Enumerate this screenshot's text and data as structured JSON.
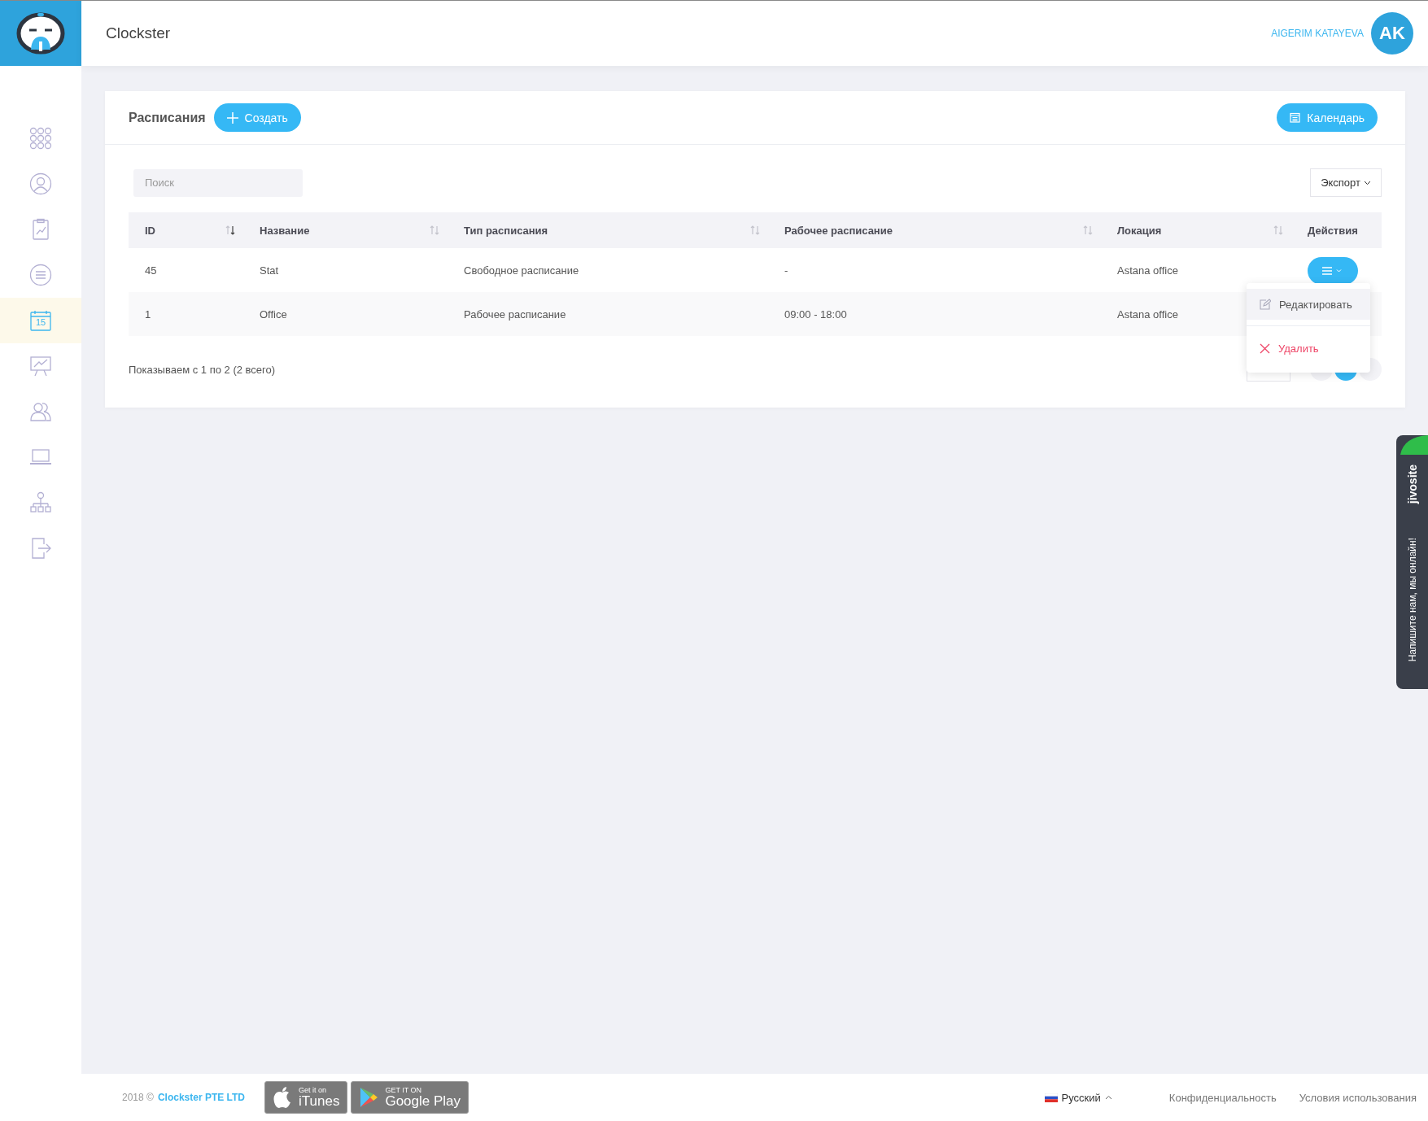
{
  "header": {
    "app_title": "Clockster",
    "user_name": "AIGERIM KATAYEVA",
    "avatar_initials": "AK"
  },
  "sidebar": {
    "items": [
      {
        "selected": false
      },
      {
        "selected": false
      },
      {
        "selected": false
      },
      {
        "selected": false
      },
      {
        "label": "15",
        "selected": true
      },
      {
        "selected": false
      },
      {
        "selected": false
      },
      {
        "selected": false
      },
      {
        "selected": false
      },
      {
        "selected": false
      }
    ]
  },
  "card": {
    "title": "Расписания",
    "create_button": "Создать",
    "calendar_button": "Календарь"
  },
  "search": {
    "placeholder": "Поиск"
  },
  "export_button": "Экспорт",
  "table": {
    "columns": [
      {
        "label": "ID",
        "sorted": true
      },
      {
        "label": "Название",
        "sorted": false
      },
      {
        "label": "Тип расписания",
        "sorted": false
      },
      {
        "label": "Рабочее расписание",
        "sorted": false
      },
      {
        "label": "Локация",
        "sorted": false
      },
      {
        "label": "Действия"
      }
    ],
    "rows": [
      {
        "cells": [
          "45",
          "Stat",
          "Свободное расписание",
          "-",
          "Astana office"
        ]
      },
      {
        "cells": [
          "1",
          "Office",
          "Рабочее расписание",
          "09:00 - 18:00",
          "Astana office"
        ]
      }
    ]
  },
  "actions_menu": {
    "open": true,
    "items": [
      {
        "kind": "edit",
        "label": "Редактировать"
      },
      {
        "kind": "delete",
        "label": "Удалить"
      }
    ]
  },
  "summary": "Показываем с 1 по 2 (2 всего)",
  "chat_tab": {
    "brand": "jivosite",
    "message": "Напишите нам, мы онлайн!"
  },
  "footer": {
    "copyright": "2018 ©",
    "company": "Clockster PTE LTD",
    "badges": [
      {
        "kind": "apple",
        "small": "Get it on",
        "big": "iTunes"
      },
      {
        "kind": "google",
        "small": "GET IT ON",
        "big": "Google Play"
      }
    ],
    "language": "Русский",
    "links": [
      "Конфиденциальность",
      "Условия использования"
    ]
  }
}
